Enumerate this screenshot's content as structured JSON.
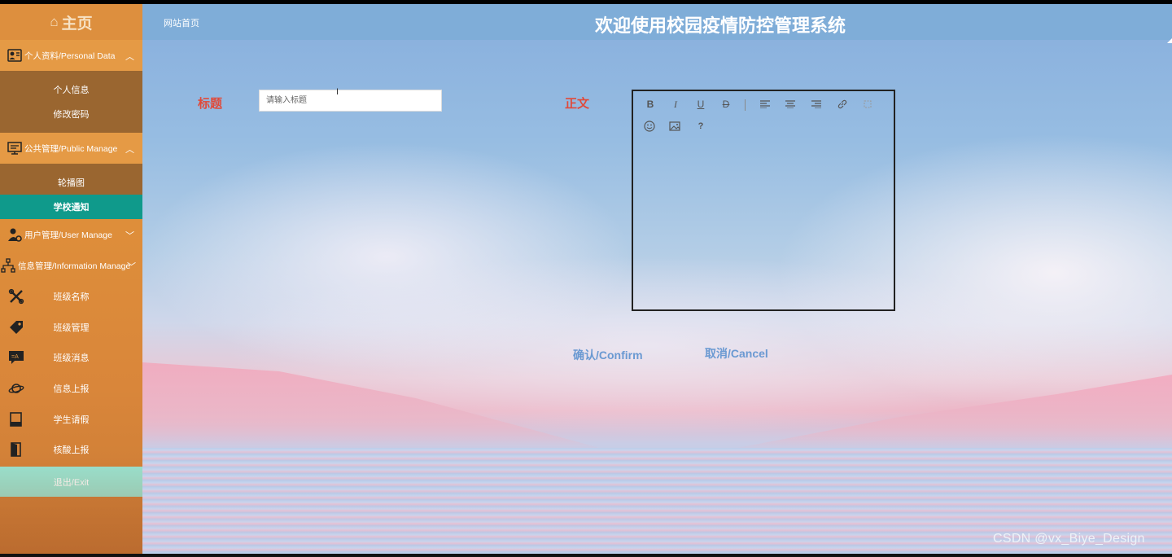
{
  "sidebar": {
    "home_label": "主页",
    "groups": [
      {
        "label": "个人资料/Personal Data",
        "icon": "user-card-icon",
        "expanded": true,
        "items": [
          "个人信息",
          "修改密码"
        ]
      },
      {
        "label": "公共管理/Public Manage",
        "icon": "monitor-icon",
        "expanded": true,
        "items": [
          "轮播图",
          "学校通知"
        ]
      },
      {
        "label": "用户管理/User Manage",
        "icon": "user-gear-icon",
        "expanded": false
      },
      {
        "label": "信息管理/Information Manage",
        "icon": "hierarchy-icon",
        "expanded": false
      }
    ],
    "active_item": "学校通知",
    "menu": [
      {
        "label": "班级名称",
        "icon": "tools-icon"
      },
      {
        "label": "班级管理",
        "icon": "tags-icon"
      },
      {
        "label": "班级消息",
        "icon": "translate-chat-icon"
      },
      {
        "label": "信息上报",
        "icon": "planet-icon"
      },
      {
        "label": "学生请假",
        "icon": "book-icon"
      },
      {
        "label": "核酸上报",
        "icon": "door-exit-icon"
      }
    ],
    "exit_label": "退出/Exit"
  },
  "header": {
    "breadcrumb": "网站首页",
    "title": "欢迎使用校园疫情防控管理系统"
  },
  "form": {
    "title_label": "标题",
    "title_placeholder": "请输入标题",
    "body_label": "正文",
    "toolbar": [
      "bold-icon",
      "italic-icon",
      "underline-icon",
      "strikethrough-icon",
      "align-left-icon",
      "align-center-icon",
      "align-right-icon",
      "link-icon",
      "unlink-icon",
      "emoji-icon",
      "image-icon",
      "help-icon"
    ],
    "confirm_label": "确认/Confirm",
    "cancel_label": "取消/Cancel"
  },
  "watermark": "CSDN @vx_Biye_Design",
  "colors": {
    "sidebar_orange": "#e59a45",
    "submenu_brown": "#9a6630",
    "active_teal": "#0f9a8b",
    "exit_mint": "#98e4d2",
    "header_blue": "#7fadd8",
    "label_red": "#e04a3a",
    "button_blue": "#6a99d2"
  }
}
